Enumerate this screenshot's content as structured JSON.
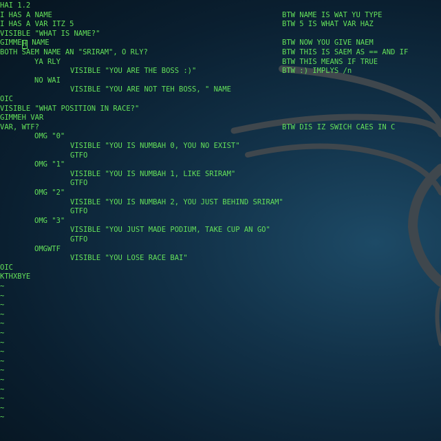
{
  "editor": {
    "cursor_row": 4,
    "lines": [
      {
        "code": "HAI 1.2",
        "indent": 0,
        "comment": ""
      },
      {
        "code": "I HAS A NAME",
        "indent": 0,
        "comment": "BTW NAME IS WAT YU TYPE"
      },
      {
        "code": "I HAS A VAR ITZ 5",
        "indent": 0,
        "comment": "BTW 5 IS WHAT VAR HAZ"
      },
      {
        "code": "VISIBLE \"WHAT IS NAME?\"",
        "indent": 0,
        "comment": ""
      },
      {
        "code_before_cursor": "GIMME",
        "cursor_char": "H",
        "code": " NAME",
        "indent": 0,
        "comment": "BTW NOW YOU GIVE NAEM"
      },
      {
        "code": "BOTH SAEM NAME AN \"SRIRAM\", O RLY?",
        "indent": 0,
        "comment": "BTW THIS IS SAEM AS == AND IF"
      },
      {
        "code": "YA RLY",
        "indent": 1,
        "comment": "BTW THIS MEANS IF TRUE"
      },
      {
        "code": "VISIBLE \"YOU ARE THE BOSS :)\"",
        "indent": 2,
        "comment": "BTW :) IMPLYS /n"
      },
      {
        "code": "NO WAI",
        "indent": 1,
        "comment": ""
      },
      {
        "code": "VISIBLE \"YOU ARE NOT TEH BOSS, \" NAME",
        "indent": 2,
        "comment": ""
      },
      {
        "code": "OIC",
        "indent": 0,
        "comment": ""
      },
      {
        "code": "VISIBLE \"WHAT POSITION IN RACE?\"",
        "indent": 0,
        "comment": ""
      },
      {
        "code": "GIMMEH VAR",
        "indent": 0,
        "comment": ""
      },
      {
        "code": "VAR, WTF?",
        "indent": 0,
        "comment": "BTW DIS IZ SWICH CAES IN C"
      },
      {
        "code": "OMG \"0\"",
        "indent": 1,
        "comment": ""
      },
      {
        "code": "VISIBLE \"YOU IS NUMBAH 0, YOU NO EXIST\"",
        "indent": 2,
        "comment": ""
      },
      {
        "code": "GTFO",
        "indent": 2,
        "comment": ""
      },
      {
        "code": "OMG \"1\"",
        "indent": 1,
        "comment": ""
      },
      {
        "code": "VISIBLE \"YOU IS NUMBAH 1, LIKE SRIRAM\"",
        "indent": 2,
        "comment": ""
      },
      {
        "code": "GTFO",
        "indent": 2,
        "comment": ""
      },
      {
        "code": "OMG \"2\"",
        "indent": 1,
        "comment": ""
      },
      {
        "code": "VISIBLE \"YOU IS NUMBAH 2, YOU JUST BEHIND SRIRAM\"",
        "indent": 2,
        "comment": ""
      },
      {
        "code": "GTFO",
        "indent": 2,
        "comment": ""
      },
      {
        "code": "OMG \"3\"",
        "indent": 1,
        "comment": ""
      },
      {
        "code": "VISIBLE \"YOU JUST MADE PODIUM, TAKE CUP AN GO\"",
        "indent": 2,
        "comment": ""
      },
      {
        "code": "GTFO",
        "indent": 2,
        "comment": ""
      },
      {
        "code": "OMGWTF",
        "indent": 1,
        "comment": ""
      },
      {
        "code": "VISIBLE \"YOU LOSE RACE BAI\"",
        "indent": 2,
        "comment": ""
      },
      {
        "code": "OIC",
        "indent": 0,
        "comment": ""
      },
      {
        "code": "KTHXBYE",
        "indent": 0,
        "comment": ""
      }
    ],
    "empty_line_marker": "~",
    "empty_line_count": 15
  },
  "colors": {
    "text": "#64e05a",
    "background": "#0d2638",
    "wallpaper_stroke": "#3a4248"
  },
  "wallpaper": {
    "icon": "kali-dragon-icon"
  }
}
